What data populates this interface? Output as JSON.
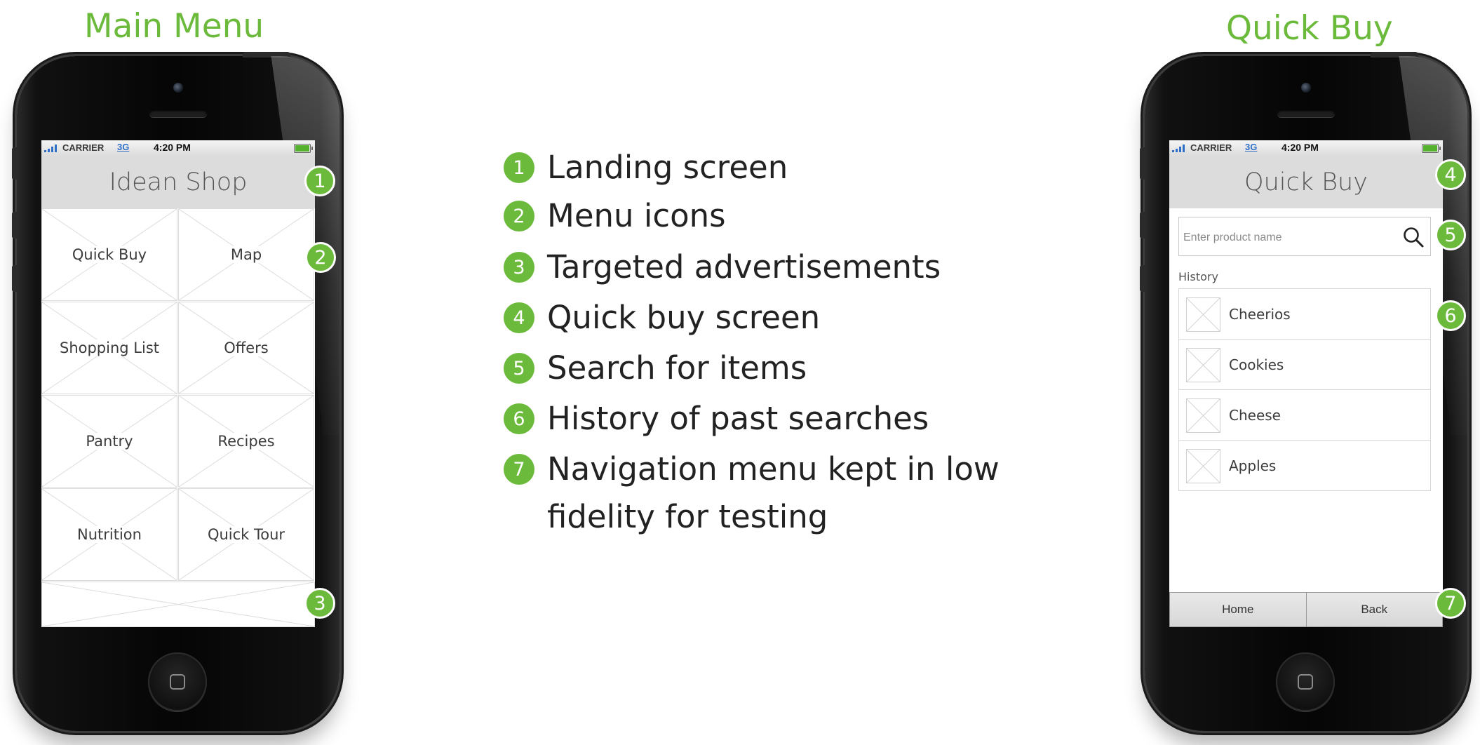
{
  "titles": {
    "left": "Main Menu",
    "right": "Quick Buy"
  },
  "status_bar": {
    "carrier": "CARRIER",
    "network": "3G",
    "time": "4:20 PM"
  },
  "main_menu": {
    "header": "Idean Shop",
    "items": [
      "Quick Buy",
      "Map",
      "Shopping List",
      "Offers",
      "Pantry",
      "Recipes",
      "Nutrition",
      "Quick Tour"
    ]
  },
  "quick_buy": {
    "header": "Quick Buy",
    "search_placeholder": "Enter product name",
    "history_label": "History",
    "history_items": [
      "Cheerios",
      "Cookies",
      "Cheese",
      "Apples"
    ],
    "nav": {
      "home": "Home",
      "back": "Back"
    }
  },
  "markers": [
    "1",
    "2",
    "3",
    "4",
    "5",
    "6",
    "7"
  ],
  "legend": [
    {
      "num": "1",
      "text": "Landing screen"
    },
    {
      "num": "2",
      "text": "Menu icons"
    },
    {
      "num": "3",
      "text": "Targeted advertisements"
    },
    {
      "num": "4",
      "text": "Quick buy screen"
    },
    {
      "num": "5",
      "text": "Search for items"
    },
    {
      "num": "6",
      "text": "History of past searches"
    },
    {
      "num": "7",
      "text": "Navigation menu kept in low",
      "text2": "fidelity for testing"
    }
  ],
  "colors": {
    "accent": "#6cba3c",
    "header_bg": "#dcdcdc",
    "phone_body": "#0b0b0b",
    "network_blue": "#2f6fc8"
  },
  "icons": {
    "search": "search-icon",
    "signal": "signal-icon",
    "battery": "battery-icon",
    "home": "home-button-icon"
  }
}
